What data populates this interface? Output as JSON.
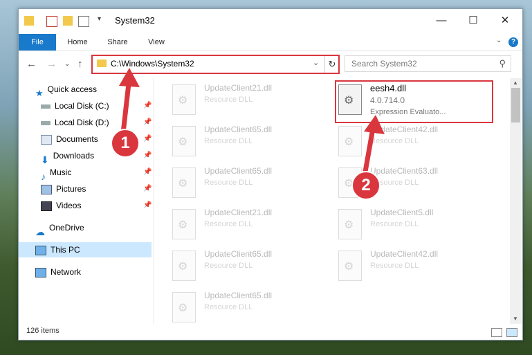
{
  "window": {
    "title": "System32",
    "minimize": "—",
    "maximize": "☐",
    "close": "✕"
  },
  "ribbon": {
    "tabs": [
      "File",
      "Home",
      "Share",
      "View"
    ],
    "help": "?"
  },
  "address": {
    "path": "C:\\Windows\\System32",
    "search_placeholder": "Search System32"
  },
  "nav": {
    "quick_access": "Quick access",
    "items": [
      {
        "label": "Local Disk (C:)",
        "icon": "drive-icon"
      },
      {
        "label": "Local Disk (D:)",
        "icon": "drive-icon"
      },
      {
        "label": "Documents",
        "icon": "documents-icon"
      },
      {
        "label": "Downloads",
        "icon": "downloads-icon"
      },
      {
        "label": "Music",
        "icon": "music-icon"
      },
      {
        "label": "Pictures",
        "icon": "pictures-icon"
      },
      {
        "label": "Videos",
        "icon": "videos-icon"
      }
    ],
    "onedrive": "OneDrive",
    "this_pc": "This PC",
    "network": "Network"
  },
  "files": {
    "left": [
      {
        "name": "UpdateClient21.dll",
        "desc": "Resource DLL"
      },
      {
        "name": "UpdateClient65.dll",
        "desc": "Resource DLL"
      },
      {
        "name": "UpdateClient65.dll",
        "desc": "Resource DLL"
      },
      {
        "name": "UpdateClient21.dll",
        "desc": "Resource DLL"
      },
      {
        "name": "UpdateClient65.dll",
        "desc": "Resource DLL"
      },
      {
        "name": "UpdateClient65.dll",
        "desc": "Resource DLL"
      }
    ],
    "right": [
      {
        "name": "UpdateClient42.dll",
        "desc": "Resource DLL"
      },
      {
        "name": "UpdateClient63.dll",
        "desc": "Resource DLL"
      },
      {
        "name": "UpdateClient5.dll",
        "desc": "Resource DLL"
      },
      {
        "name": "UpdateClient42.dll",
        "desc": "Resource DLL"
      }
    ],
    "highlighted": {
      "name": "eesh4.dll",
      "version": "4.0.714.0",
      "desc": "Expression Evaluato..."
    }
  },
  "status": {
    "count": "126 items"
  },
  "annotations": {
    "badge1": "1",
    "badge2": "2"
  },
  "colors": {
    "accent": "#1979ca",
    "highlight": "#d9363e"
  }
}
